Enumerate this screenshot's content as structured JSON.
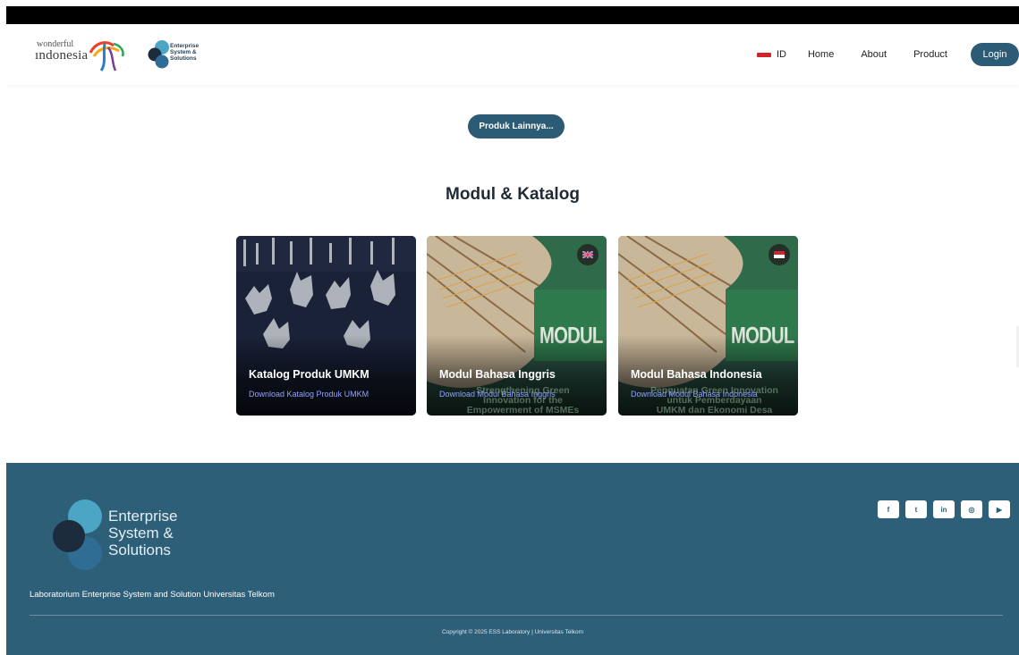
{
  "nav": {
    "logo_wonderful": "wonderful",
    "logo_indonesia": "ındonesia",
    "logo_ess": [
      "Enterprise",
      "System &",
      "Solutions"
    ],
    "lang": "ID",
    "links": [
      "Home",
      "About",
      "Product"
    ],
    "login": "Login"
  },
  "main": {
    "more_button": "Produk Lainnya...",
    "section_title": "Modul & Katalog",
    "cards": [
      {
        "title": "Katalog Produk UMKM",
        "link": "Download Katalog Produk UMKM"
      },
      {
        "title": "Modul Bahasa Inggris",
        "link": "Download Modul Bahasa Inggris",
        "cover_word": "MODUL",
        "cover_text": [
          "Strengthening Green",
          "Innovation for the",
          "Empowerment of MSMEs"
        ],
        "badge": "uk-flag-icon"
      },
      {
        "title": "Modul Bahasa Indonesia",
        "link": "Download Modul Bahasa Indonesia",
        "cover_word": "MODUL",
        "cover_text": [
          "Penguatan Green Innovation",
          "untuk Pemberdayaan",
          "UMKM dan Ekonomi Desa"
        ],
        "badge": "id-flag-icon"
      }
    ]
  },
  "footer": {
    "logo_text": [
      "Enterprise",
      "System &",
      "Solutions"
    ],
    "description": "Laboratorium Enterprise System and Solution Universitas Telkom",
    "copyright": "Copyright © 2025 ESS Laboratory | Universitas Telkom",
    "socials": [
      "f",
      "t",
      "in",
      "◎",
      "▶"
    ]
  },
  "colors": {
    "primary": "#2c5b76",
    "footer_bg": "#2d5f79",
    "link": "#8fa2ff"
  }
}
